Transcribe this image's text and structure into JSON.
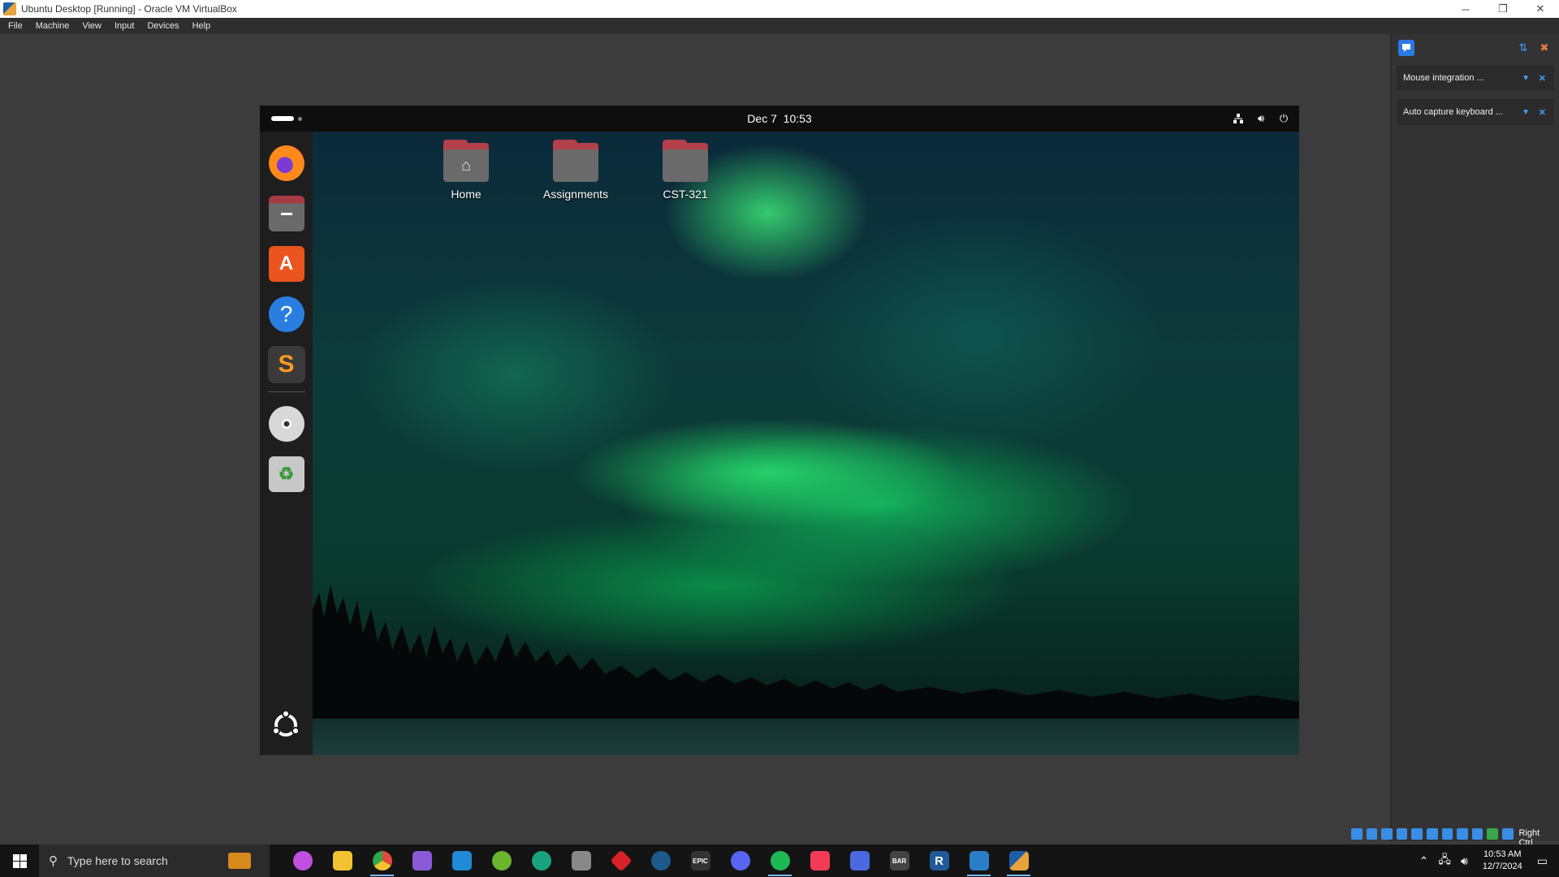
{
  "window": {
    "title": "Ubuntu Desktop [Running] - Oracle VM VirtualBox",
    "controls": {
      "minimize": "─",
      "restore": "❐",
      "close": "✕"
    }
  },
  "menubar": {
    "items": [
      "File",
      "Machine",
      "View",
      "Input",
      "Devices",
      "Help"
    ]
  },
  "notifications": {
    "items": [
      {
        "text": "Mouse integration ..."
      },
      {
        "text": "Auto capture keyboard ..."
      }
    ]
  },
  "vm": {
    "topbar": {
      "date": "Dec 7",
      "time": "10:53"
    },
    "dock": {
      "apps": [
        {
          "name": "firefox-icon"
        },
        {
          "name": "files-icon"
        },
        {
          "name": "app-center-icon"
        },
        {
          "name": "help-icon",
          "glyph": "?"
        },
        {
          "name": "sublime-text-icon",
          "glyph": "S"
        },
        {
          "name": "dvd-icon"
        },
        {
          "name": "trash-icon",
          "glyph": "♻"
        }
      ]
    },
    "desktop": {
      "icons": [
        {
          "label": "Home"
        },
        {
          "label": "Assignments"
        },
        {
          "label": "CST-321"
        }
      ]
    }
  },
  "statusbar": {
    "host_key": "Right Ctrl"
  },
  "taskbar": {
    "search_placeholder": "Type here to search",
    "apps": [
      {
        "name": "copilot-icon",
        "color": "#c050e0"
      },
      {
        "name": "file-explorer-icon",
        "color": "#f2c230"
      },
      {
        "name": "chrome-icon",
        "color": "#e04a3c"
      },
      {
        "name": "visual-studio-icon",
        "color": "#8a5ad6"
      },
      {
        "name": "vscode-icon",
        "color": "#1f8ad6"
      },
      {
        "name": "spring-tools-icon",
        "color": "#6ab42e"
      },
      {
        "name": "openai-icon",
        "color": "#18a37e"
      },
      {
        "name": "inkscape-icon",
        "color": "#888888"
      },
      {
        "name": "ruby-icon",
        "color": "#d8222a"
      },
      {
        "name": "steam-icon",
        "color": "#1b5a8a"
      },
      {
        "name": "epic-games-icon",
        "color": "#333333",
        "text": "EPIC"
      },
      {
        "name": "discord-icon",
        "color": "#5865f2"
      },
      {
        "name": "spotify-icon",
        "color": "#1db954"
      },
      {
        "name": "apple-music-icon",
        "color": "#f23c55"
      },
      {
        "name": "media-player-icon",
        "color": "#4a6ae0"
      },
      {
        "name": "bar-icon",
        "color": "#444444",
        "text": "BAR"
      },
      {
        "name": "r-studio-icon",
        "color": "#1f5a9a",
        "text": "R"
      },
      {
        "name": "virtualbox-manager-icon",
        "color": "#2a7ec8"
      },
      {
        "name": "virtualbox-vm-icon",
        "color": "#e8a33c"
      }
    ],
    "clock": {
      "time": "10:53 AM",
      "date": "12/7/2024"
    }
  }
}
